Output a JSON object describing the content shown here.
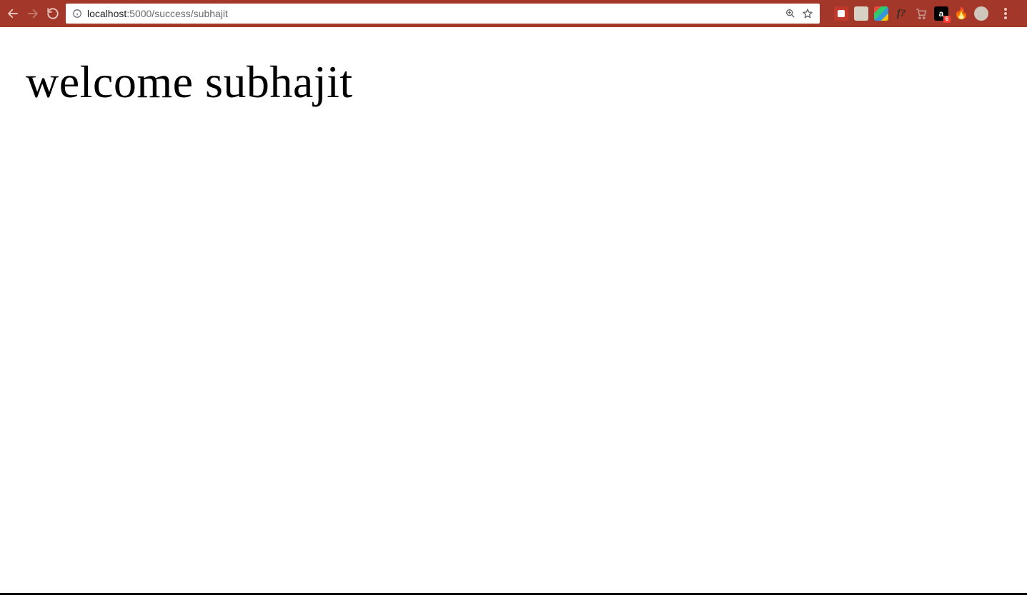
{
  "browser": {
    "url_host": "localhost",
    "url_rest": ":5000/success/subhajit",
    "nav": {
      "back_enabled": true,
      "forward_enabled": false
    },
    "extensions": {
      "f_label": "f?",
      "amazon_label": "a",
      "amazon_badge": "6",
      "fire_glyph": "🔥"
    }
  },
  "page": {
    "heading_text": "welcome subhajit"
  }
}
